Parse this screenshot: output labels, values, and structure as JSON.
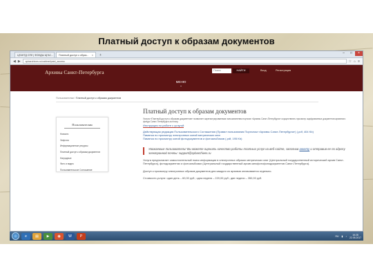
{
  "slide": {
    "title": "Платный доступ к образам документов"
  },
  "browser": {
    "tabs": [
      {
        "label": "ЦГАНТД СПб | ФОНДЫ ЦГАС..."
      },
      {
        "label": "Платный доступ к образ..."
      }
    ],
    "url": "spbarchives.ru/cabinet/paid_access"
  },
  "site": {
    "logo": "Архивы Санкт-Петербурга",
    "search_placeholder": "Поиск",
    "search_button": "НАЙТИ",
    "login": "Вход",
    "register": "Регистрация",
    "menu": "МЕНЮ"
  },
  "breadcrumb": {
    "parent": "Пользователям",
    "current": "Платный доступ к образам документов"
  },
  "sidebar": {
    "title": "Пользователям",
    "items": [
      "Новости",
      "Запросы",
      "Информационные ресурсы",
      "Платный доступ к образам документов",
      "Наградные",
      "Фото и видео",
      "Пользовательское Соглашение"
    ]
  },
  "main": {
    "title": "Платный доступ к образам документов",
    "intro": "Услуга «Платный доступ к образам документов» позволяет зарегистрированным пользователям портала «Архивы Санкт-Петербурга» осуществлять просмотр оцифрованных документов архивного фонда Санкт-Петербурга за плату.",
    "instruction": "Инструкция по работе с услугой",
    "links": [
      "Действующая редакция Пользовательского Соглашения (Правил пользования Порталом «Архивы Санкт-Петербурга») (.pdf, 404 Kb)",
      "Памятка по просмотру электронных копий метрических книг",
      "Памятка по просмотру копий фотодокументов и фотоальбомов (.pdf, 195 Kb)"
    ],
    "notice_text": "Уважаемые пользователи! Вы можете оценить качество работы платных услуг на веб-сайте, заполнив",
    "notice_link": "анкету",
    "notice_tail": "и отправив ее по адресу электронной почты: support@spbarchives.ru",
    "para1": "Услуга предполагает самостоятельный поиск информации в электронных образах метрических книг (Центральный государственный исторический архив Санкт-Петербурга), фотодокументах и фотоальбомах (Центральный государственный архив кинофотофонодокументов Санкт-Петербурга).",
    "para2": "Доступ к просмотру электронных образов документов для каждого из архивов оплачивается отдельно.",
    "para3": "Стоимость услуги: один день – 60,00 руб.; одна неделя – 220,00 руб.; две недели – 350,00 руб."
  },
  "taskbar": {
    "lang": "RU",
    "time": "16:28",
    "date": "22.05.2017"
  }
}
